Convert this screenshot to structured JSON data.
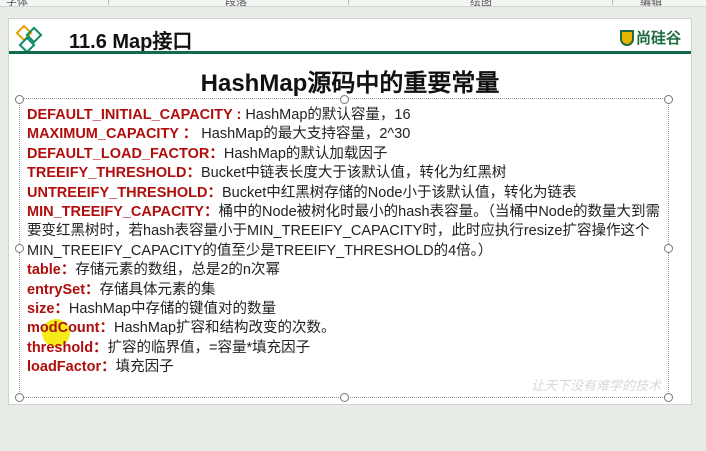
{
  "ribbon": {
    "groups": [
      "字体",
      "段落",
      "绘图",
      "编辑"
    ]
  },
  "slide": {
    "header_title": "11.6 Map接口",
    "brand": "尚硅谷",
    "title": "HashMap源码中的重要常量",
    "items": [
      {
        "key": "DEFAULT_INITIAL_CAPACITY :",
        "text": " HashMap的默认容量，16"
      },
      {
        "key": "MAXIMUM_CAPACITY ：",
        "text": " HashMap的最大支持容量，2^30"
      },
      {
        "key": "DEFAULT_LOAD_FACTOR：",
        "text": "HashMap的默认加载因子"
      },
      {
        "key": "TREEIFY_THRESHOLD：",
        "text": "Bucket中链表长度大于该默认值，转化为红黑树"
      },
      {
        "key": "UNTREEIFY_THRESHOLD：",
        "text": "Bucket中红黑树存储的Node小于该默认值，转化为链表"
      },
      {
        "key": "MIN_TREEIFY_CAPACITY：",
        "text": "桶中的Node被树化时最小的hash表容量。（当桶中Node的数量大到需要变红黑树时，若hash表容量小于MIN_TREEIFY_CAPACITY时，此时应执行resize扩容操作这个MIN_TREEIFY_CAPACITY的值至少是TREEIFY_THRESHOLD的4倍。）"
      },
      {
        "key": "table：",
        "text": "存储元素的数组，总是2的n次幂"
      },
      {
        "key": "entrySet：",
        "text": "存储具体元素的集"
      },
      {
        "key": "size：",
        "text": "HashMap中存储的键值对的数量"
      },
      {
        "key": "modCount：",
        "text": "HashMap扩容和结构改变的次数。"
      },
      {
        "key": "threshold：",
        "text": "扩容的临界值，=容量*填充因子"
      },
      {
        "key": "loadFactor：",
        "text": "填充因子"
      }
    ],
    "watermark": "让天下没有难学的技术"
  },
  "colors": {
    "key": "#b00d0d",
    "accent": "#0f6b48"
  }
}
